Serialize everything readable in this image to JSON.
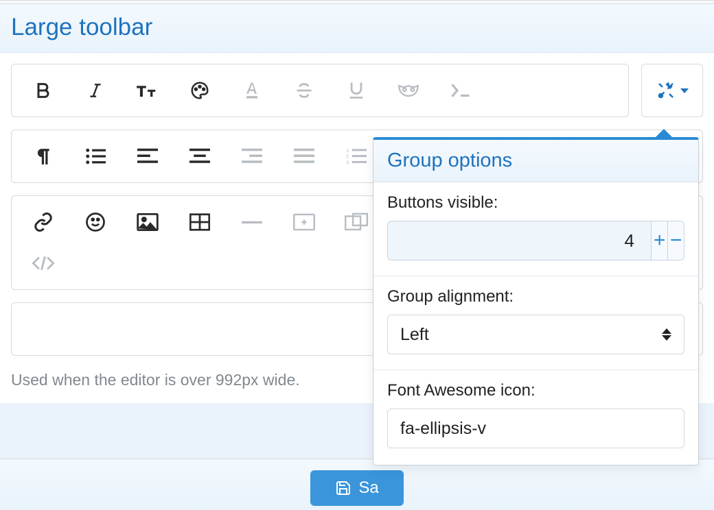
{
  "header": {
    "title": "Large toolbar"
  },
  "toolbar": {
    "row1": [
      {
        "name": "bold-icon",
        "dim": false
      },
      {
        "name": "italic-icon",
        "dim": false
      },
      {
        "name": "text-size-icon",
        "dim": false
      },
      {
        "name": "palette-icon",
        "dim": false
      },
      {
        "name": "font-color-icon",
        "dim": true
      },
      {
        "name": "strikethrough-icon",
        "dim": true
      },
      {
        "name": "underline-icon",
        "dim": true
      },
      {
        "name": "mask-icon",
        "dim": true
      },
      {
        "name": "terminal-icon",
        "dim": true
      }
    ],
    "row2": [
      {
        "name": "paragraph-icon",
        "dim": false
      },
      {
        "name": "list-ul-icon",
        "dim": false
      },
      {
        "name": "align-left-icon",
        "dim": false
      },
      {
        "name": "align-center-icon",
        "dim": false
      },
      {
        "name": "align-right-icon",
        "dim": true
      },
      {
        "name": "align-justify-icon",
        "dim": true
      },
      {
        "name": "list-ol-icon",
        "dim": true
      }
    ],
    "row3": [
      {
        "name": "link-icon",
        "dim": false
      },
      {
        "name": "smile-icon",
        "dim": false
      },
      {
        "name": "image-icon",
        "dim": false
      },
      {
        "name": "table-icon",
        "dim": false
      },
      {
        "name": "hr-icon",
        "dim": true
      },
      {
        "name": "video-icon",
        "dim": true
      },
      {
        "name": "image-overlay-icon",
        "dim": true
      }
    ],
    "row3b": [
      {
        "name": "code-icon",
        "dim": true
      }
    ],
    "settings_icon_name": "tools-icon"
  },
  "popover": {
    "title": "Group options",
    "buttons_visible_label": "Buttons visible:",
    "buttons_visible_value": "4",
    "group_alignment_label": "Group alignment:",
    "group_alignment_value": "Left",
    "fa_icon_label": "Font Awesome icon:",
    "fa_icon_value": "fa-ellipsis-v"
  },
  "info_text": "Used when the editor is over 992px wide.",
  "save_label": "Sa"
}
